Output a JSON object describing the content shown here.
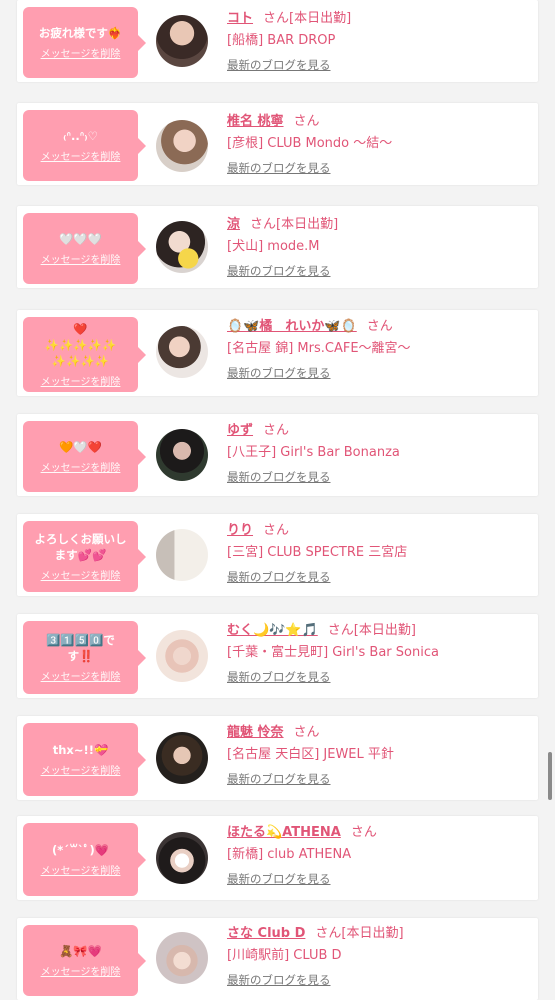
{
  "theme": {
    "accent": "#e15577",
    "bubble": "#ff9eb0",
    "link_gray": "#777777"
  },
  "delete_label": "メッセージを削除",
  "blog_label": "最新のブログを見る",
  "honorific": "さん",
  "cards": [
    {
      "message": "お疲れ様です❤️‍🔥",
      "name": "コト",
      "badge": "[本日出勤]",
      "shop": "[船橋] BAR DROP",
      "avatar_icon": "girl-photo"
    },
    {
      "message": "₍ᐢ..ᐢ₎♡",
      "name": "椎名 桃寧",
      "badge": "",
      "shop": "[彦根] CLUB Mondo 〜結〜",
      "avatar_icon": "girl-photo"
    },
    {
      "message": "🤍🤍🤍",
      "name": "涼",
      "badge": "[本日出勤]",
      "shop": "[犬山] mode.M",
      "avatar_icon": "girl-photo-chick"
    },
    {
      "message": "❤️\n✨✨✨✨✨\n✨✨✨✨",
      "name": "🪞🦋橘　れいか🦋🪞",
      "badge": "",
      "shop": "[名古屋 錦] Mrs.CAFE〜離宮〜",
      "avatar_icon": "girl-photo"
    },
    {
      "message": "🧡🤍❤️",
      "name": "ゆず",
      "badge": "",
      "shop": "[八王子] Girl's Bar Bonanza",
      "avatar_icon": "girl-photo"
    },
    {
      "message": "よろしくお願いし\nます💕💕",
      "name": "りり",
      "badge": "",
      "shop": "[三宮] CLUB SPECTRE 三宮店",
      "avatar_icon": "girl-photo"
    },
    {
      "message": "3️⃣1️⃣5️⃣0️⃣で\nす‼️",
      "name": "むく🌙🎶⭐🎵",
      "badge": "[本日出勤]",
      "shop": "[千葉・富士見町] Girl's Bar Sonica",
      "avatar_icon": "girl-photo"
    },
    {
      "message": "thx~!!💝",
      "name": "龍魅 怜奈",
      "badge": "",
      "shop": "[名古屋 天白区] JEWEL 平針",
      "avatar_icon": "girl-photo"
    },
    {
      "message": "(*´꒳`ﾟ)💗",
      "name": "ほたる💫ATHENA",
      "badge": "",
      "shop": "[新橋] club ATHENA",
      "avatar_icon": "girl-photo"
    },
    {
      "message": "🧸🎀💗",
      "name": "さな Club D",
      "badge": "[本日出勤]",
      "shop": "[川崎駅前] CLUB D",
      "avatar_icon": "girl-photo"
    }
  ]
}
